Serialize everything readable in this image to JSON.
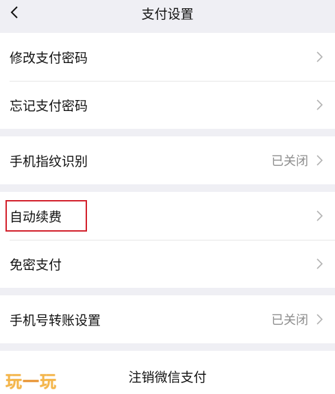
{
  "nav": {
    "title": "支付设置"
  },
  "groups": [
    {
      "items": [
        {
          "label": "修改支付密码"
        },
        {
          "label": "忘记支付密码"
        }
      ]
    },
    {
      "items": [
        {
          "label": "手机指纹识别",
          "status": "已关闭"
        }
      ]
    },
    {
      "items": [
        {
          "label": "自动续费",
          "highlighted": true
        },
        {
          "label": "免密支付"
        }
      ]
    },
    {
      "items": [
        {
          "label": "手机号转账设置",
          "status": "已关闭"
        }
      ]
    }
  ],
  "footer": {
    "deregister_label": "注销微信支付"
  },
  "watermark": {
    "chars": [
      "玩",
      "一",
      "玩"
    ]
  },
  "colors": {
    "background": "#efeff4",
    "highlight_box": "#d21f2a",
    "watermark": "#f4b64a"
  }
}
